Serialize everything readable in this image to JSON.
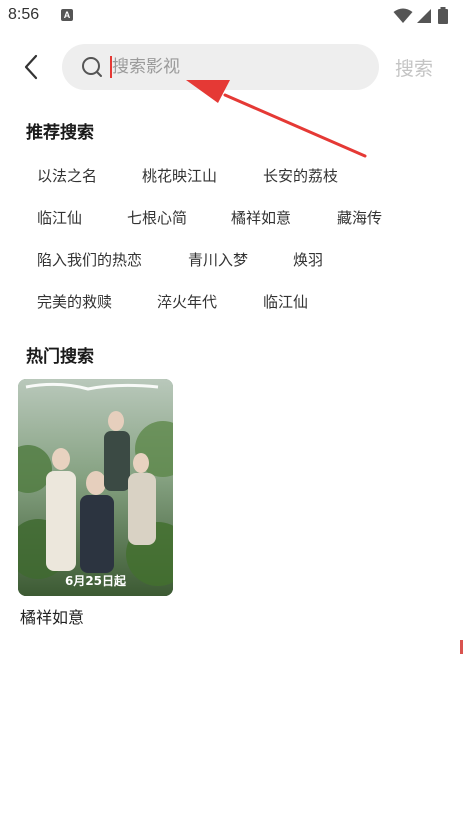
{
  "status_bar": {
    "time": "8:56",
    "app_icon_letter": "A"
  },
  "search": {
    "placeholder": "搜索影视",
    "button_label": "搜索"
  },
  "recommended": {
    "title": "推荐搜索",
    "tags": [
      "以法之名",
      "桃花映江山",
      "长安的荔枝",
      "临江仙",
      "七根心简",
      "橘祥如意",
      "藏海传",
      "陷入我们的热恋",
      "青川入梦",
      "焕羽",
      "完美的救赎",
      "淬火年代",
      "临江仙"
    ]
  },
  "hot": {
    "title": "热门搜索",
    "items": [
      {
        "title": "橘祥如意",
        "poster_title": "橘祥如意",
        "poster_date": "6月25日起"
      }
    ]
  },
  "colors": {
    "search_bg": "#eeeeee",
    "caret": "#e53935",
    "annotation_arrow": "#e53935",
    "search_button": "#c4c4c4"
  }
}
